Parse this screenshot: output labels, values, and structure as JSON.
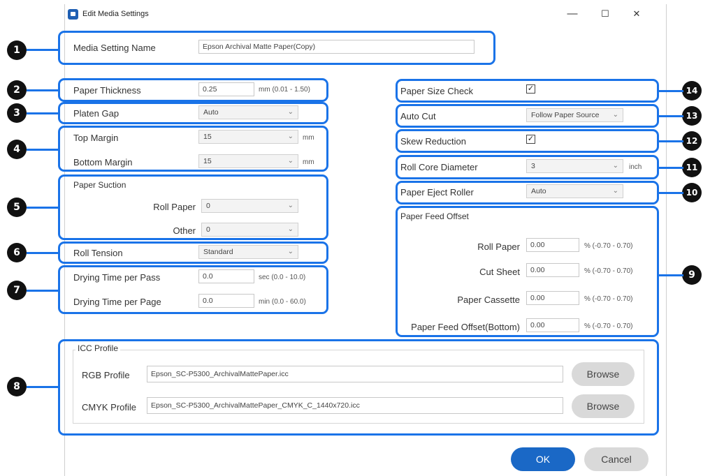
{
  "window": {
    "title": "Edit Media Settings",
    "minimize": "—",
    "maximize": "☐",
    "close": "✕"
  },
  "callouts": [
    "1",
    "2",
    "3",
    "4",
    "5",
    "6",
    "7",
    "8",
    "9",
    "10",
    "11",
    "12",
    "13",
    "14"
  ],
  "left": {
    "media_setting_name": {
      "label": "Media Setting Name",
      "value": "Epson Archival Matte Paper(Copy)"
    },
    "paper_thickness": {
      "label": "Paper Thickness",
      "value": "0.25",
      "unit": "mm (0.01 - 1.50)"
    },
    "platen_gap": {
      "label": "Platen Gap",
      "value": "Auto"
    },
    "top_margin": {
      "label": "Top Margin",
      "value": "15",
      "unit": "mm"
    },
    "bottom_margin": {
      "label": "Bottom Margin",
      "value": "15",
      "unit": "mm"
    },
    "paper_suction": {
      "label": "Paper Suction",
      "roll_label": "Roll Paper",
      "roll_value": "0",
      "other_label": "Other",
      "other_value": "0"
    },
    "roll_tension": {
      "label": "Roll Tension",
      "value": "Standard"
    },
    "drying_pass": {
      "label": "Drying Time per Pass",
      "value": "0.0",
      "unit": "sec (0.0 - 10.0)"
    },
    "drying_page": {
      "label": "Drying Time per Page",
      "value": "0.0",
      "unit": "min (0.0 - 60.0)"
    }
  },
  "right": {
    "paper_size_check": {
      "label": "Paper Size Check",
      "checked": "☑"
    },
    "auto_cut": {
      "label": "Auto Cut",
      "value": "Follow Paper Source"
    },
    "skew_reduction": {
      "label": "Skew Reduction",
      "checked": "☑"
    },
    "roll_core": {
      "label": "Roll Core Diameter",
      "value": "3",
      "unit": "inch"
    },
    "eject_roller": {
      "label": "Paper Eject Roller",
      "value": "Auto"
    },
    "feed_offset": {
      "title": "Paper Feed Offset",
      "rows": [
        {
          "label": "Roll Paper",
          "value": "0.00",
          "unit": "% (-0.70 - 0.70)"
        },
        {
          "label": "Cut Sheet",
          "value": "0.00",
          "unit": "% (-0.70 - 0.70)"
        },
        {
          "label": "Paper Cassette",
          "value": "0.00",
          "unit": "% (-0.70 - 0.70)"
        },
        {
          "label": "Paper Feed Offset(Bottom)",
          "value": "0.00",
          "unit": "% (-0.70 - 0.70)"
        }
      ]
    }
  },
  "icc": {
    "title": "ICC Profile",
    "rgb_label": "RGB Profile",
    "rgb_value": "Epson_SC-P5300_ArchivalMattePaper.icc",
    "cmyk_label": "CMYK Profile",
    "cmyk_value": "Epson_SC-P5300_ArchivalMattePaper_CMYK_C_1440x720.icc",
    "browse": "Browse"
  },
  "footer": {
    "ok": "OK",
    "cancel": "Cancel"
  },
  "colors": {
    "callout_blue": "#1a73e8",
    "ok_blue": "#1a68c6"
  }
}
